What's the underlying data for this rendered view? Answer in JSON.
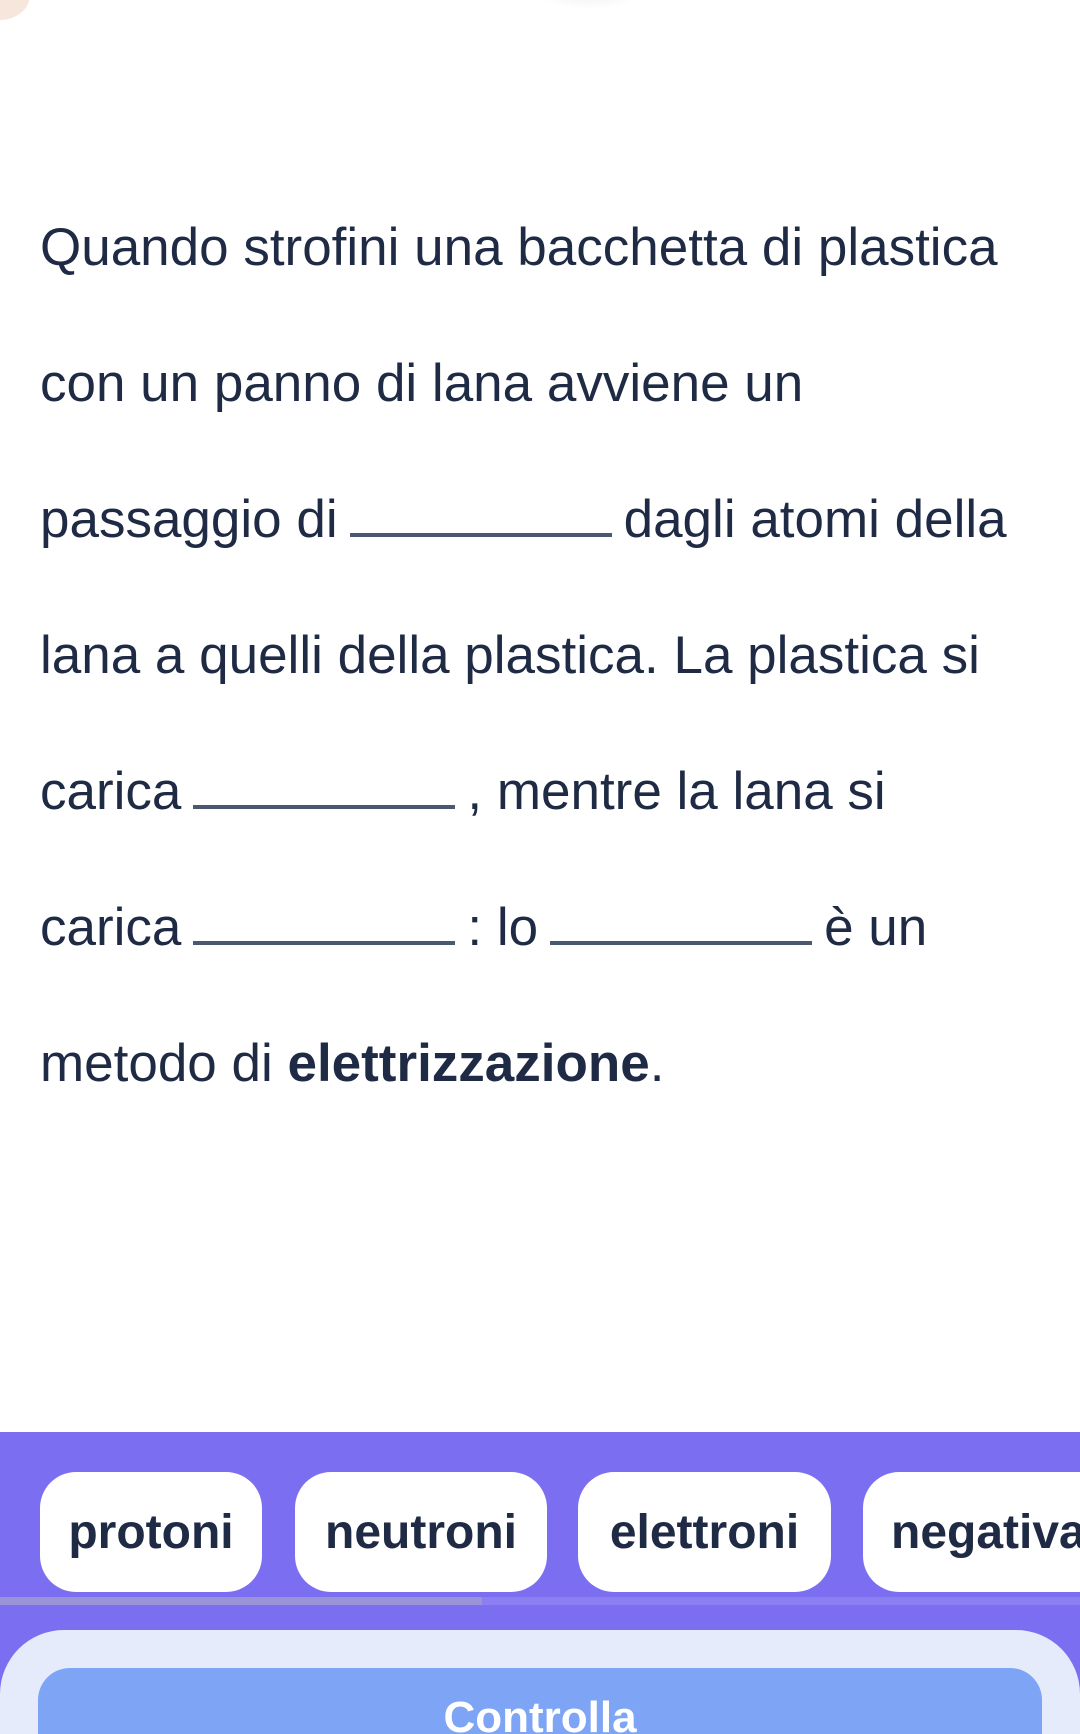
{
  "exercise": {
    "line1": "Quando strofini una bacchetta di plastica",
    "line2": "con un panno di lana avviene un",
    "line3_before": "passaggio di",
    "line3_after": "dagli atomi della",
    "line4": "lana a quelli della plastica. La plastica si",
    "line5_before": "carica",
    "line5_after": ", mentre la lana si",
    "line6_before": "carica",
    "line6_mid": ": lo",
    "line6_after": "è un",
    "line7_before": "metodo di ",
    "line7_bold": "elettrizzazione",
    "line7_after": "."
  },
  "chips": [
    {
      "label": "protoni"
    },
    {
      "label": "neutroni"
    },
    {
      "label": "elettroni"
    },
    {
      "label": "negativa"
    }
  ],
  "footer": {
    "check_label": "Controlla"
  },
  "colors": {
    "text": "#1f2a44",
    "chip_bar": "#7b6ef0",
    "chip_bg": "#ffffff",
    "button_bg": "#7ea5f5",
    "sheet_bg": "#e6ebfb"
  }
}
